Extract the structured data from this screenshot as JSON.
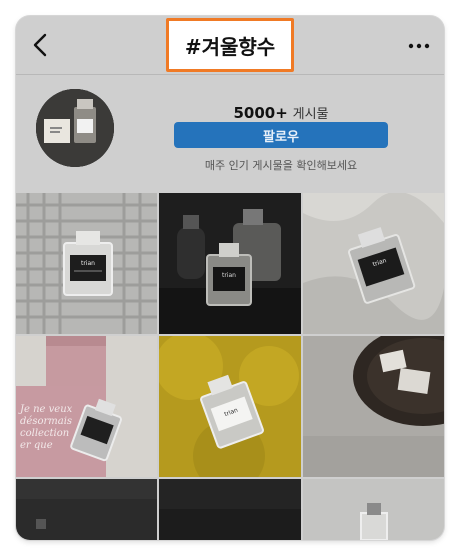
{
  "header": {
    "title": "#겨울향수"
  },
  "profile": {
    "post_count": "5000+",
    "post_label": "게시물",
    "follow_label": "팔로우",
    "description": "매주 인기 게시물을 확인해보세요"
  },
  "posts": [
    {
      "bottle_text": "trian"
    },
    {
      "bottle_text": "trian"
    },
    {
      "bottle_text": "trian"
    },
    {
      "card_lines": [
        "Je ne veux",
        "désormais",
        "collection",
        "er que"
      ]
    },
    {
      "bottle_text": "trian"
    },
    {
      "bottle_text": ""
    }
  ],
  "icons": {
    "back": "chevron-left-icon",
    "more": "more-horizontal-icon"
  },
  "colors": {
    "accent": "#2573bb",
    "highlight": "#f07a25",
    "background": "#cfcfcf"
  }
}
